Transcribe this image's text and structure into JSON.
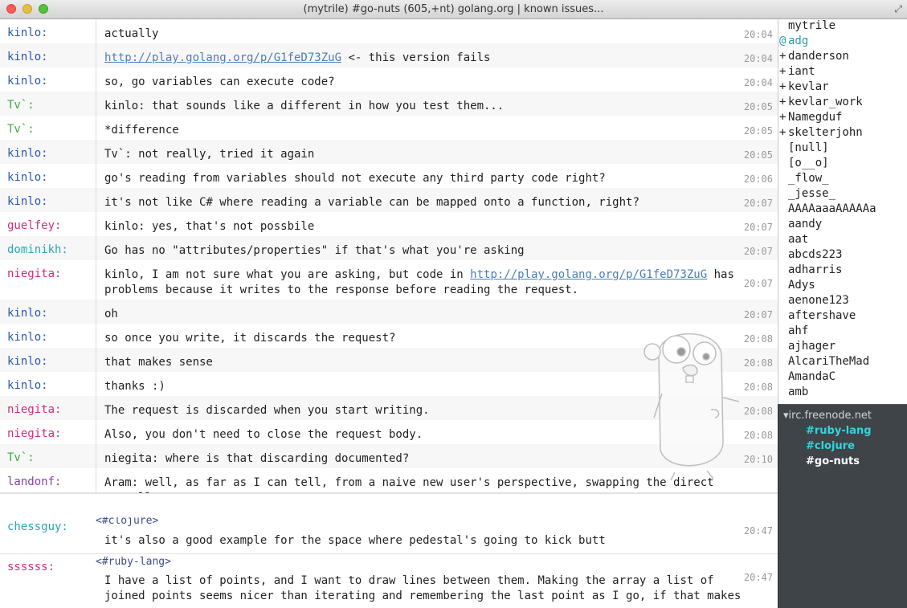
{
  "window": {
    "title": "(mytrile) #go-nuts (605,+nt) golang.org | known issues..."
  },
  "colors": {
    "kinlo": "#2a55b8",
    "tv": "#3cab3c",
    "guelfey": "#d62b78",
    "dominikh": "#2aa6b8",
    "niegita": "#d62b78",
    "landonf": "#8a3fb2",
    "chessguy": "#2aa6b8",
    "ssssss": "#d62b78"
  },
  "messages": [
    {
      "nick": "kinlo:",
      "color": "#2a55b8",
      "text": "actually",
      "time": "20:04"
    },
    {
      "nick": "kinlo:",
      "color": "#2a55b8",
      "link": "http://play.golang.org/p/G1feD73ZuG",
      "text": " <- this version fails",
      "time": "20:04"
    },
    {
      "nick": "kinlo:",
      "color": "#2a55b8",
      "text": "so, go variables can execute code?",
      "time": "20:04"
    },
    {
      "nick": "Tv`:",
      "color": "#3cab3c",
      "text": "kinlo: that sounds like a different in how you test them...",
      "time": "20:05"
    },
    {
      "nick": "Tv`:",
      "color": "#3cab3c",
      "text": "*difference",
      "time": "20:05"
    },
    {
      "nick": "kinlo:",
      "color": "#2a55b8",
      "text": "Tv`: not really, tried it again",
      "time": "20:05"
    },
    {
      "nick": "kinlo:",
      "color": "#2a55b8",
      "text": "go's reading from variables should not execute any third party code right?",
      "time": "20:06"
    },
    {
      "nick": "kinlo:",
      "color": "#2a55b8",
      "text": "it's not like C# where reading a variable can be mapped onto a function, right?",
      "time": "20:07"
    },
    {
      "nick": "guelfey:",
      "color": "#d62b78",
      "text": "kinlo: yes, that's not possbile",
      "time": "20:07"
    },
    {
      "nick": "dominikh:",
      "color": "#2aa6b8",
      "text": "Go has no \"attributes/properties\" if that's what you're asking",
      "time": "20:07"
    },
    {
      "nick": "niegita:",
      "color": "#d62b78",
      "pre": "kinlo, I am not sure what you are asking, but code in ",
      "link": "http://play.golang.org/p/G1feD73ZuG",
      "text": " has problems because it writes to the response before reading the request.",
      "time": "20:07"
    },
    {
      "nick": "kinlo:",
      "color": "#2a55b8",
      "text": "oh",
      "time": "20:07"
    },
    {
      "nick": "kinlo:",
      "color": "#2a55b8",
      "text": "so once you write, it discards the request?",
      "time": "20:08"
    },
    {
      "nick": "kinlo:",
      "color": "#2a55b8",
      "text": "that makes sense",
      "time": "20:08"
    },
    {
      "nick": "kinlo:",
      "color": "#2a55b8",
      "text": "thanks :)",
      "time": "20:08"
    },
    {
      "nick": "niegita:",
      "color": "#d62b78",
      "text": "The request is discarded when you start writing.",
      "time": "20:08"
    },
    {
      "nick": "niegita:",
      "color": "#d62b78",
      "text": "Also, you don't need to close the request body.",
      "time": "20:08"
    },
    {
      "nick": "Tv`:",
      "color": "#3cab3c",
      "text": "niegita: where is that discarding documented?",
      "time": "20:10"
    },
    {
      "nick": "landonf:",
      "color": "#8a3fb2",
      "text": "Aram: well, as far as I can tell, from a naive new user's perspective, swapping the direct syscall",
      "time": ""
    }
  ],
  "highlights": [
    {
      "nick": "chessguy:",
      "color": "#2aa6b8",
      "channel": "<#clojure>",
      "text": "it's also a good example for the space where pedestal's going to kick butt",
      "time": "20:47"
    },
    {
      "nick": "ssssss:",
      "color": "#d62b78",
      "channel": "<#ruby-lang>",
      "text": "I have a list of points, and I want to draw lines between them. Making the array a list of joined points seems nicer than iterating and remembering the last point as I go, if that makes sense",
      "time": "20:47"
    }
  ],
  "users": [
    {
      "prefix": "",
      "name": "mytrile"
    },
    {
      "prefix": "@",
      "name": "adg",
      "op": true
    },
    {
      "prefix": "+",
      "name": "danderson"
    },
    {
      "prefix": "+",
      "name": "iant"
    },
    {
      "prefix": "+",
      "name": "kevlar"
    },
    {
      "prefix": "+",
      "name": "kevlar_work"
    },
    {
      "prefix": "+",
      "name": "Namegduf"
    },
    {
      "prefix": "+",
      "name": "skelterjohn"
    },
    {
      "prefix": "",
      "name": "[null]"
    },
    {
      "prefix": "",
      "name": "[o__o]"
    },
    {
      "prefix": "",
      "name": "_flow_"
    },
    {
      "prefix": "",
      "name": "_jesse_"
    },
    {
      "prefix": "",
      "name": "AAAAaaaAAAAAa"
    },
    {
      "prefix": "",
      "name": "aandy"
    },
    {
      "prefix": "",
      "name": "aat"
    },
    {
      "prefix": "",
      "name": "abcds223"
    },
    {
      "prefix": "",
      "name": "adharris"
    },
    {
      "prefix": "",
      "name": "Adys"
    },
    {
      "prefix": "",
      "name": "aenone123"
    },
    {
      "prefix": "",
      "name": "aftershave"
    },
    {
      "prefix": "",
      "name": "ahf"
    },
    {
      "prefix": "",
      "name": "ajhager"
    },
    {
      "prefix": "",
      "name": "AlcariTheMad"
    },
    {
      "prefix": "",
      "name": "AmandaC"
    },
    {
      "prefix": "",
      "name": "amb"
    }
  ],
  "tree": {
    "server": "irc.freenode.net",
    "channels": [
      {
        "name": "#ruby-lang",
        "color": "#34d4e0"
      },
      {
        "name": "#clojure",
        "color": "#34d4e0"
      },
      {
        "name": "#go-nuts",
        "color": "#ffffff"
      }
    ]
  }
}
